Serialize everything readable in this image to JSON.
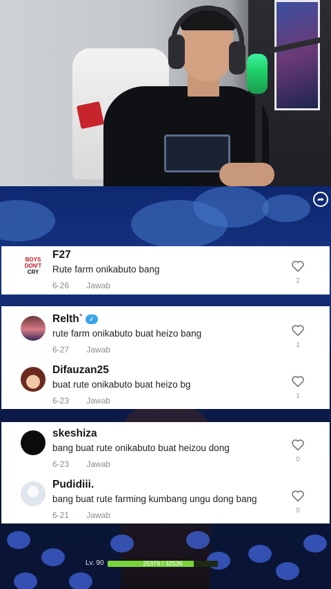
{
  "comments_top": [
    {
      "username": "F27",
      "text": "Rute farm onikabuto bang",
      "date": "6-26",
      "reply": "Jawab",
      "likes": "2",
      "avatar": "f27-logo"
    }
  ],
  "comments_mid": [
    {
      "username": "Relth`",
      "text": "rute farm onikabuto buat heizo bang",
      "date": "6-27",
      "reply": "Jawab",
      "likes": "1",
      "avatar": "anime-avatar"
    },
    {
      "username": "Difauzan25",
      "text": "buat rute onikabuto buat heizo bg",
      "date": "6-23",
      "reply": "Jawab",
      "likes": "1",
      "avatar": "anime-avatar"
    }
  ],
  "comments_bottom": [
    {
      "username": "skeshiza",
      "text": "bang buat rute onikabuto buat heizou dong",
      "date": "6-23",
      "reply": "Jawab",
      "likes": "0",
      "avatar": "black-avatar"
    },
    {
      "username": "Pudidiii.",
      "text": "bang buat rute farming kumbang ungu dong bang",
      "date": "6-21",
      "reply": "Jawab",
      "likes": "0",
      "avatar": "white-avatar"
    }
  ],
  "hud": {
    "level": "Lv. 90",
    "hp": "25379 / 32536",
    "hp_fraction": 0.78
  },
  "colors": {
    "card_bg": "#ffffff",
    "hp_green": "#78d23a",
    "sky": "#163581"
  }
}
